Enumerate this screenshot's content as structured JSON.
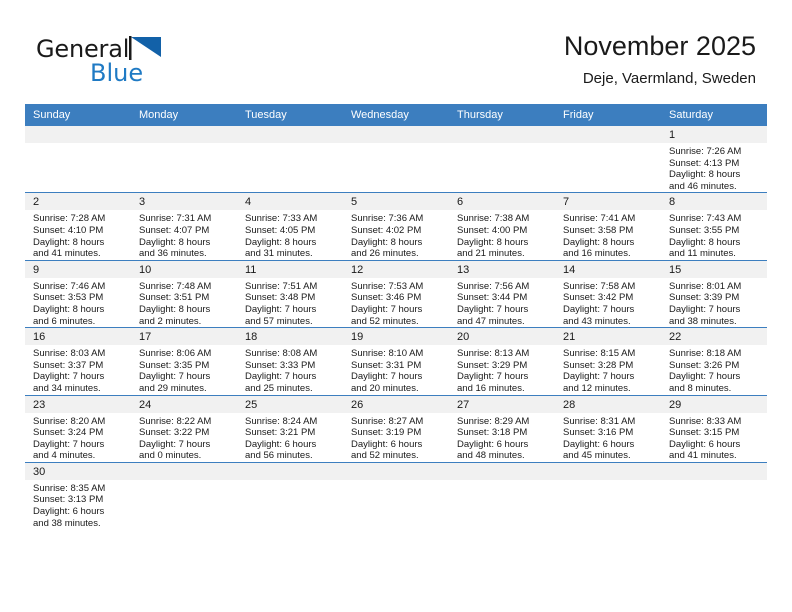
{
  "brand": {
    "name_dark": "General",
    "name_blue": "Blue",
    "flag_icon": "blue-triangle-flag",
    "blue_color": "#1f7ac4"
  },
  "header": {
    "title": "November 2025",
    "subtitle": "Deje, Vaermland, Sweden"
  },
  "theme": {
    "header_blue": "#3c7ebf",
    "daynum_band": "#f1f1f1",
    "text": "#1a1a1a"
  },
  "weekday_headers": [
    "Sunday",
    "Monday",
    "Tuesday",
    "Wednesday",
    "Thursday",
    "Friday",
    "Saturday"
  ],
  "weeks": [
    [
      {
        "day": "",
        "empty": true
      },
      {
        "day": "",
        "empty": true
      },
      {
        "day": "",
        "empty": true
      },
      {
        "day": "",
        "empty": true
      },
      {
        "day": "",
        "empty": true
      },
      {
        "day": "",
        "empty": true
      },
      {
        "day": "1",
        "sunrise": "Sunrise: 7:26 AM",
        "sunset": "Sunset: 4:13 PM",
        "daylight_line1": "Daylight: 8 hours",
        "daylight_line2": "and 46 minutes."
      }
    ],
    [
      {
        "day": "2",
        "sunrise": "Sunrise: 7:28 AM",
        "sunset": "Sunset: 4:10 PM",
        "daylight_line1": "Daylight: 8 hours",
        "daylight_line2": "and 41 minutes."
      },
      {
        "day": "3",
        "sunrise": "Sunrise: 7:31 AM",
        "sunset": "Sunset: 4:07 PM",
        "daylight_line1": "Daylight: 8 hours",
        "daylight_line2": "and 36 minutes."
      },
      {
        "day": "4",
        "sunrise": "Sunrise: 7:33 AM",
        "sunset": "Sunset: 4:05 PM",
        "daylight_line1": "Daylight: 8 hours",
        "daylight_line2": "and 31 minutes."
      },
      {
        "day": "5",
        "sunrise": "Sunrise: 7:36 AM",
        "sunset": "Sunset: 4:02 PM",
        "daylight_line1": "Daylight: 8 hours",
        "daylight_line2": "and 26 minutes."
      },
      {
        "day": "6",
        "sunrise": "Sunrise: 7:38 AM",
        "sunset": "Sunset: 4:00 PM",
        "daylight_line1": "Daylight: 8 hours",
        "daylight_line2": "and 21 minutes."
      },
      {
        "day": "7",
        "sunrise": "Sunrise: 7:41 AM",
        "sunset": "Sunset: 3:58 PM",
        "daylight_line1": "Daylight: 8 hours",
        "daylight_line2": "and 16 minutes."
      },
      {
        "day": "8",
        "sunrise": "Sunrise: 7:43 AM",
        "sunset": "Sunset: 3:55 PM",
        "daylight_line1": "Daylight: 8 hours",
        "daylight_line2": "and 11 minutes."
      }
    ],
    [
      {
        "day": "9",
        "sunrise": "Sunrise: 7:46 AM",
        "sunset": "Sunset: 3:53 PM",
        "daylight_line1": "Daylight: 8 hours",
        "daylight_line2": "and 6 minutes."
      },
      {
        "day": "10",
        "sunrise": "Sunrise: 7:48 AM",
        "sunset": "Sunset: 3:51 PM",
        "daylight_line1": "Daylight: 8 hours",
        "daylight_line2": "and 2 minutes."
      },
      {
        "day": "11",
        "sunrise": "Sunrise: 7:51 AM",
        "sunset": "Sunset: 3:48 PM",
        "daylight_line1": "Daylight: 7 hours",
        "daylight_line2": "and 57 minutes."
      },
      {
        "day": "12",
        "sunrise": "Sunrise: 7:53 AM",
        "sunset": "Sunset: 3:46 PM",
        "daylight_line1": "Daylight: 7 hours",
        "daylight_line2": "and 52 minutes."
      },
      {
        "day": "13",
        "sunrise": "Sunrise: 7:56 AM",
        "sunset": "Sunset: 3:44 PM",
        "daylight_line1": "Daylight: 7 hours",
        "daylight_line2": "and 47 minutes."
      },
      {
        "day": "14",
        "sunrise": "Sunrise: 7:58 AM",
        "sunset": "Sunset: 3:42 PM",
        "daylight_line1": "Daylight: 7 hours",
        "daylight_line2": "and 43 minutes."
      },
      {
        "day": "15",
        "sunrise": "Sunrise: 8:01 AM",
        "sunset": "Sunset: 3:39 PM",
        "daylight_line1": "Daylight: 7 hours",
        "daylight_line2": "and 38 minutes."
      }
    ],
    [
      {
        "day": "16",
        "sunrise": "Sunrise: 8:03 AM",
        "sunset": "Sunset: 3:37 PM",
        "daylight_line1": "Daylight: 7 hours",
        "daylight_line2": "and 34 minutes."
      },
      {
        "day": "17",
        "sunrise": "Sunrise: 8:06 AM",
        "sunset": "Sunset: 3:35 PM",
        "daylight_line1": "Daylight: 7 hours",
        "daylight_line2": "and 29 minutes."
      },
      {
        "day": "18",
        "sunrise": "Sunrise: 8:08 AM",
        "sunset": "Sunset: 3:33 PM",
        "daylight_line1": "Daylight: 7 hours",
        "daylight_line2": "and 25 minutes."
      },
      {
        "day": "19",
        "sunrise": "Sunrise: 8:10 AM",
        "sunset": "Sunset: 3:31 PM",
        "daylight_line1": "Daylight: 7 hours",
        "daylight_line2": "and 20 minutes."
      },
      {
        "day": "20",
        "sunrise": "Sunrise: 8:13 AM",
        "sunset": "Sunset: 3:29 PM",
        "daylight_line1": "Daylight: 7 hours",
        "daylight_line2": "and 16 minutes."
      },
      {
        "day": "21",
        "sunrise": "Sunrise: 8:15 AM",
        "sunset": "Sunset: 3:28 PM",
        "daylight_line1": "Daylight: 7 hours",
        "daylight_line2": "and 12 minutes."
      },
      {
        "day": "22",
        "sunrise": "Sunrise: 8:18 AM",
        "sunset": "Sunset: 3:26 PM",
        "daylight_line1": "Daylight: 7 hours",
        "daylight_line2": "and 8 minutes."
      }
    ],
    [
      {
        "day": "23",
        "sunrise": "Sunrise: 8:20 AM",
        "sunset": "Sunset: 3:24 PM",
        "daylight_line1": "Daylight: 7 hours",
        "daylight_line2": "and 4 minutes."
      },
      {
        "day": "24",
        "sunrise": "Sunrise: 8:22 AM",
        "sunset": "Sunset: 3:22 PM",
        "daylight_line1": "Daylight: 7 hours",
        "daylight_line2": "and 0 minutes."
      },
      {
        "day": "25",
        "sunrise": "Sunrise: 8:24 AM",
        "sunset": "Sunset: 3:21 PM",
        "daylight_line1": "Daylight: 6 hours",
        "daylight_line2": "and 56 minutes."
      },
      {
        "day": "26",
        "sunrise": "Sunrise: 8:27 AM",
        "sunset": "Sunset: 3:19 PM",
        "daylight_line1": "Daylight: 6 hours",
        "daylight_line2": "and 52 minutes."
      },
      {
        "day": "27",
        "sunrise": "Sunrise: 8:29 AM",
        "sunset": "Sunset: 3:18 PM",
        "daylight_line1": "Daylight: 6 hours",
        "daylight_line2": "and 48 minutes."
      },
      {
        "day": "28",
        "sunrise": "Sunrise: 8:31 AM",
        "sunset": "Sunset: 3:16 PM",
        "daylight_line1": "Daylight: 6 hours",
        "daylight_line2": "and 45 minutes."
      },
      {
        "day": "29",
        "sunrise": "Sunrise: 8:33 AM",
        "sunset": "Sunset: 3:15 PM",
        "daylight_line1": "Daylight: 6 hours",
        "daylight_line2": "and 41 minutes."
      }
    ],
    [
      {
        "day": "30",
        "sunrise": "Sunrise: 8:35 AM",
        "sunset": "Sunset: 3:13 PM",
        "daylight_line1": "Daylight: 6 hours",
        "daylight_line2": "and 38 minutes."
      },
      {
        "day": "",
        "empty": true
      },
      {
        "day": "",
        "empty": true
      },
      {
        "day": "",
        "empty": true
      },
      {
        "day": "",
        "empty": true
      },
      {
        "day": "",
        "empty": true
      },
      {
        "day": "",
        "empty": true
      }
    ]
  ]
}
